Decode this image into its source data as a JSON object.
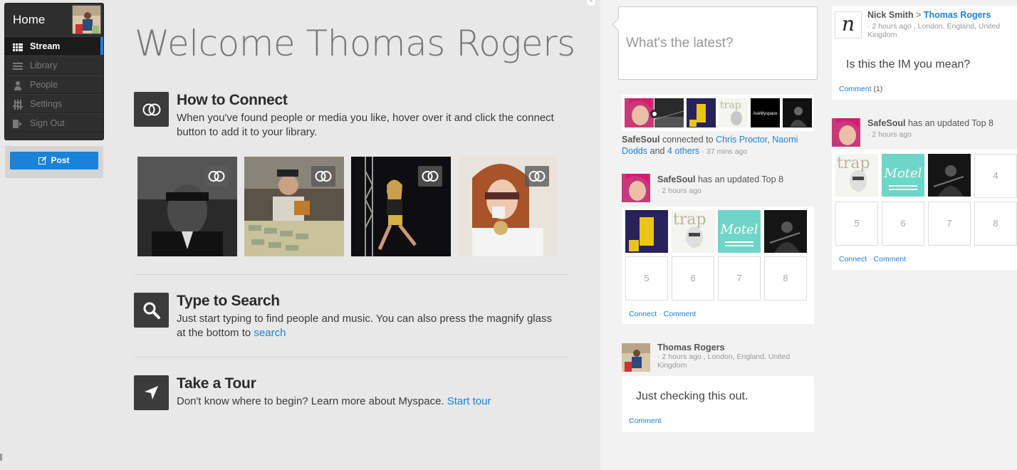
{
  "nav": {
    "home_label": "Home",
    "items": [
      {
        "label": "Stream",
        "icon": "stream-icon",
        "active": true
      },
      {
        "label": "Library",
        "icon": "library-icon",
        "active": false
      },
      {
        "label": "People",
        "icon": "people-icon",
        "active": false
      },
      {
        "label": "Settings",
        "icon": "settings-icon",
        "active": false
      },
      {
        "label": "Sign Out",
        "icon": "sign-out-icon",
        "active": false
      }
    ],
    "post_label": "Post"
  },
  "welcome": {
    "title": "Welcome Thomas Rogers",
    "connect": {
      "heading": "How to Connect",
      "text": "When you've found people or media you like, hover over it and click the connect button to add it to your library."
    },
    "search": {
      "heading": "Type to Search",
      "text": "Just start typing to find people and music. You can also press the magnify glass at the bottom to ",
      "link": "search"
    },
    "tour": {
      "heading": "Take a Tour",
      "text": "Don't know where to begin? Learn more about Myspace. ",
      "link": "Start tour"
    }
  },
  "status": {
    "placeholder": "What's the latest?"
  },
  "feed": {
    "connected": {
      "author": "SafeSoul",
      "verb": "connected to",
      "target1": "Chris Proctor",
      "sep": ",",
      "target2": "Naomi Dodds",
      "and": "and",
      "others": "4 others",
      "time": "· 37 mins ago",
      "askmyspace": "AskMyspace"
    },
    "top8_a": {
      "author": "SafeSoul",
      "text": "has an updated Top 8",
      "time": "· 2 hours ago",
      "slots": [
        "5",
        "6",
        "7",
        "8"
      ],
      "connect": "Connect",
      "comment": "Comment"
    },
    "tr_post": {
      "author": "Thomas Rogers",
      "time": "· 2 hours ago , London, England, United Kingdom",
      "body": "Just checking this out.",
      "comment": "Comment"
    }
  },
  "right": {
    "nick": {
      "author": "Nick Smith",
      "arrow": ">",
      "target": "Thomas Rogers",
      "time": "· 2 hours ago , London, England, United Kingdom",
      "body": "Is this the IM you mean?",
      "comment": "Comment",
      "count": "(1)",
      "avatar_letter": "n"
    },
    "top8_b": {
      "author": "SafeSoul",
      "text": "has an updated Top 8",
      "time": "· 2 hours ago",
      "slots": [
        "4",
        "5",
        "6",
        "7",
        "8"
      ],
      "connect": "Connect",
      "comment": "Comment"
    }
  },
  "thumb_labels": {
    "trap": "trap",
    "motel": "Motel",
    "motel_sub": "FREE UK SHIPPING & RETURNS"
  },
  "colors": {
    "accent": "#1a82d9",
    "nav_bg": "#2e2e2e",
    "tile": "#3b3b3b"
  }
}
